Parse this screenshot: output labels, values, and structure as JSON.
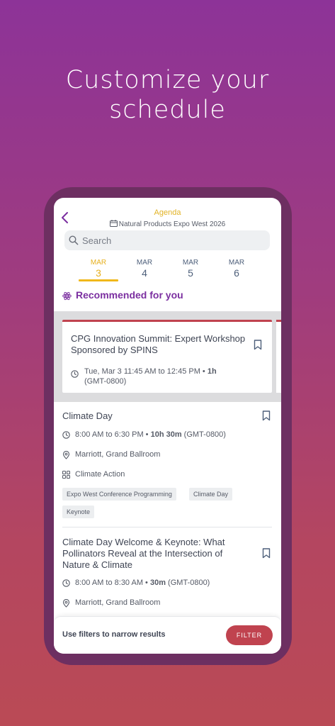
{
  "hero": {
    "line1": "Customize your",
    "line2": "schedule"
  },
  "header": {
    "title": "Agenda",
    "event_name": "Natural Products Expo West 2026"
  },
  "search": {
    "placeholder": "Search"
  },
  "days": [
    {
      "month": "MAR",
      "day": "3",
      "active": true
    },
    {
      "month": "MAR",
      "day": "4",
      "active": false
    },
    {
      "month": "MAR",
      "day": "5",
      "active": false
    },
    {
      "month": "MAR",
      "day": "6",
      "active": false
    }
  ],
  "recommended": {
    "label": "Recommended for you",
    "card": {
      "title": "CPG Innovation Summit: Expert Workshop Sponsored by SPINS",
      "time_prefix": "Tue, Mar 3 11:45 AM to 12:45 PM • ",
      "duration": "1h",
      "timezone": "(GMT-0800)"
    }
  },
  "sessions": [
    {
      "title": "Climate Day",
      "time": "8:00 AM to 6:30 PM • ",
      "duration": "10h 30m",
      "timezone": " (GMT-0800)",
      "location": "Marriott, Grand Ballroom",
      "track": "Climate Action",
      "tags": [
        "Expo West Conference Programming",
        "Climate Day",
        "Keynote"
      ]
    },
    {
      "title": "Climate Day Welcome & Keynote: What Pollinators Reveal at the Intersection of Nature & Climate",
      "time": "8:00 AM to 8:30 AM • ",
      "duration": "30m",
      "timezone": " (GMT-0800)",
      "location": "Marriott, Grand Ballroom"
    }
  ],
  "footer": {
    "hint": "Use filters to narrow results",
    "filter_label": "FILTER"
  },
  "colors": {
    "accent": "#7b2fa0",
    "brand_red": "#c0434f",
    "active_day": "#e6b01f"
  }
}
